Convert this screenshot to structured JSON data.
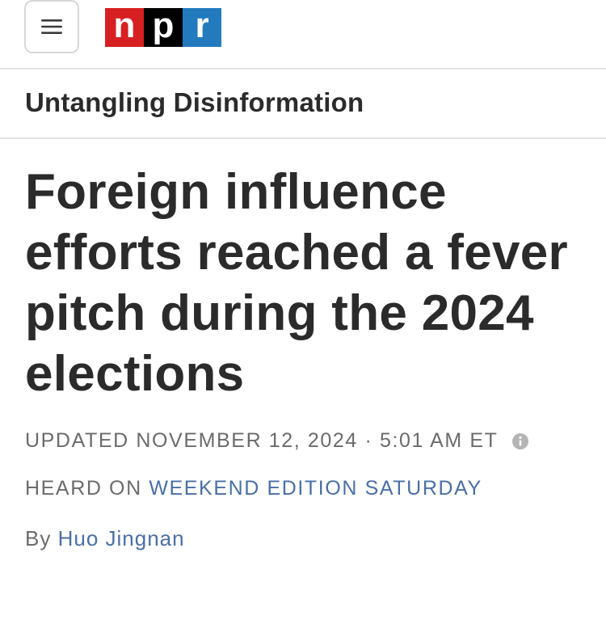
{
  "header": {
    "menu_icon": "hamburger-menu-icon",
    "logo": {
      "letters": [
        "n",
        "p",
        "r"
      ],
      "colors": [
        "#d62021",
        "#000000",
        "#237bbd"
      ]
    }
  },
  "section": {
    "label": "Untangling Disinformation"
  },
  "article": {
    "headline": "Foreign influence efforts reached a fever pitch during the 2024 elections",
    "updated_prefix": "UPDATED",
    "date": "NOVEMBER 12, 2024",
    "separator": "·",
    "time": "5:01 AM ET",
    "info_icon": "info-icon",
    "heard_on_prefix": "HEARD ON",
    "show_name": "WEEKEND EDITION SATURDAY",
    "byline_prefix": "By",
    "author": "Huo Jingnan"
  },
  "colors": {
    "text_primary": "#2b2b2b",
    "text_meta": "#6b6b6b",
    "link": "#4a6fa5",
    "divider": "#e2e2e2"
  }
}
